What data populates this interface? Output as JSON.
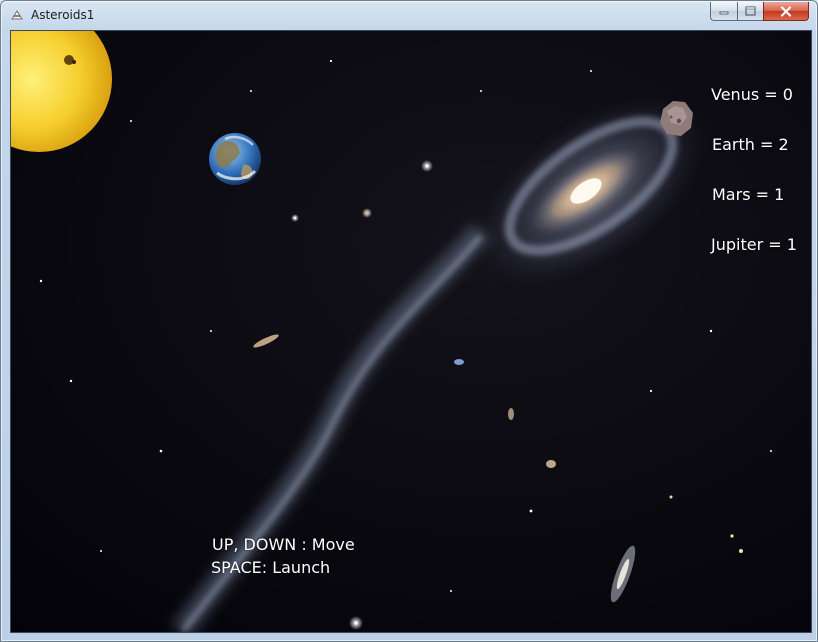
{
  "window": {
    "title": "Asteroids1",
    "icon": "java-app-icon",
    "controls": [
      "minimize-icon",
      "maximize-icon",
      "close-icon"
    ]
  },
  "game": {
    "scores": [
      {
        "planet": "Venus",
        "text": "Venus = 0"
      },
      {
        "planet": "Earth",
        "text": "Earth = 2"
      },
      {
        "planet": "Mars",
        "text": "Mars = 1"
      },
      {
        "planet": "Jupiter",
        "text": "Jupiter = 1"
      }
    ],
    "instructions": {
      "move": "UP, DOWN : Move",
      "launch": "SPACE: Launch"
    },
    "sprites": [
      "sun",
      "earth",
      "asteroid"
    ],
    "background": "deep-field-galaxy"
  }
}
